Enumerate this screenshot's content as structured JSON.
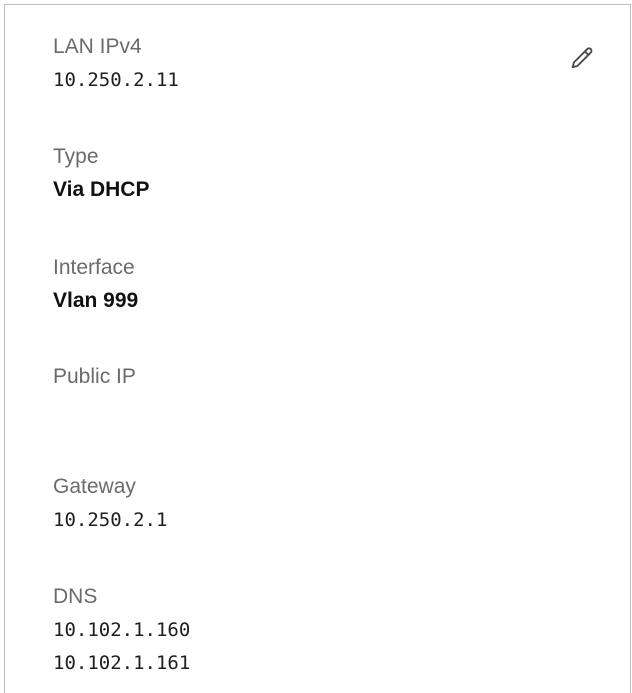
{
  "fields": {
    "lan_ipv4": {
      "label": "LAN IPv4",
      "value": "10.250.2.11"
    },
    "type": {
      "label": "Type",
      "value": "Via DHCP"
    },
    "interface": {
      "label": "Interface",
      "value": "Vlan 999"
    },
    "public_ip": {
      "label": "Public IP",
      "value": ""
    },
    "gateway": {
      "label": "Gateway",
      "value": "10.250.2.1"
    },
    "dns": {
      "label": "DNS",
      "values": [
        "10.102.1.160",
        "10.102.1.161"
      ]
    }
  },
  "icons": {
    "edit": "pencil-icon"
  },
  "colors": {
    "label": "#6b6b6b",
    "value": "#1f1f1f",
    "border": "#bdbdbd"
  }
}
